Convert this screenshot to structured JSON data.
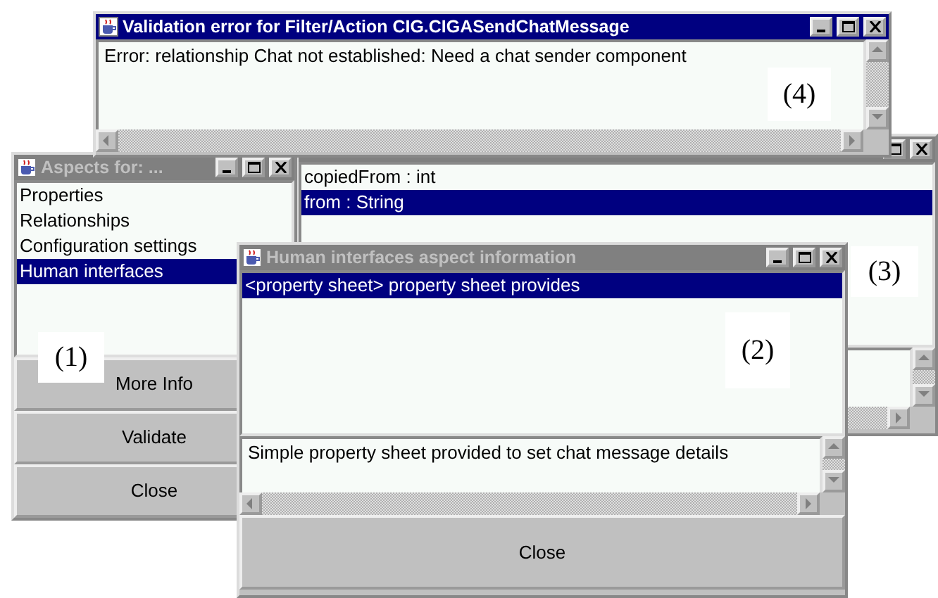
{
  "attributes_window": {
    "items": [
      {
        "label": "copiedFrom : int",
        "selected": false
      },
      {
        "label": "from : String",
        "selected": true
      }
    ],
    "callout": "(3)"
  },
  "aspects_window": {
    "title": "Aspects for: ...",
    "active": false,
    "items": [
      {
        "label": "Properties",
        "selected": false
      },
      {
        "label": "Relationships",
        "selected": false
      },
      {
        "label": "Configuration settings",
        "selected": false
      },
      {
        "label": "Human interfaces",
        "selected": true
      }
    ],
    "buttons": [
      "More Info",
      "Validate",
      "Close"
    ],
    "callout": "(1)"
  },
  "info_window": {
    "title": "Human interfaces aspect information",
    "active": false,
    "items": [
      {
        "label": "<property sheet> property sheet provides",
        "selected": true
      }
    ],
    "description": "Simple property sheet provided to set chat message details",
    "buttons": [
      "Close"
    ],
    "callout": "(2)"
  },
  "error_window": {
    "title": "Validation error for Filter/Action CIG.CIGASendChatMessage",
    "active": true,
    "message": "Error: relationship Chat not established: Need a chat sender component",
    "callout": "(4)"
  }
}
